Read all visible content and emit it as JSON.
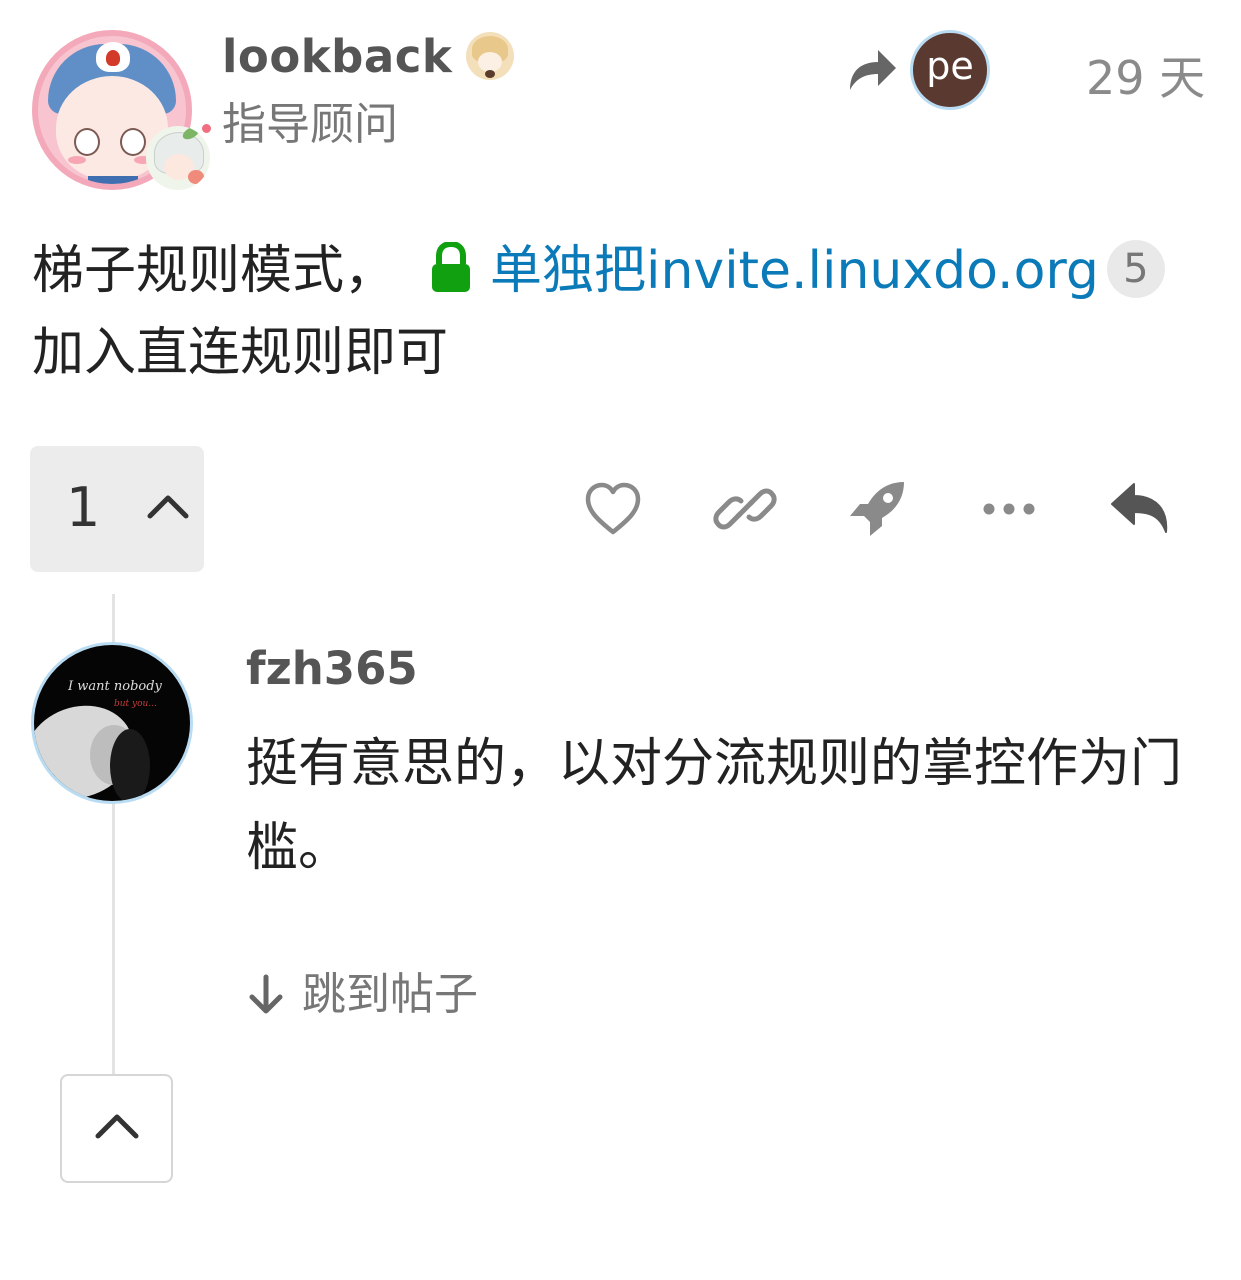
{
  "post": {
    "author": {
      "username": "lookback",
      "title": "指导顾问",
      "avatar_icon": "anime-avatar",
      "flair_icon": "anime-flair",
      "emoji_icon": "anime-emoji"
    },
    "reply_to": {
      "icon": "share-arrow-icon",
      "avatar_text": "pe",
      "avatar_color": "#5a3a30"
    },
    "date": "29 天",
    "body": {
      "text_before": "梯子规则模式，",
      "link_text": "单独把invite.linuxdo.org",
      "link_color": "#0a7ab8",
      "link_clicks": "5",
      "text_after": "加入直连规则即可",
      "lock_icon": "lock-icon",
      "lock_color": "#10a010"
    },
    "actions": {
      "replies_count": "1",
      "buttons": [
        "heart-icon",
        "link-icon",
        "rocket-icon",
        "ellipsis-icon",
        "reply-icon"
      ]
    }
  },
  "embedded_reply": {
    "username": "fzh365",
    "avatar_icon": "photo-avatar",
    "avatar_text_line1": "I want nobody",
    "avatar_text_line2": "but you...",
    "body": "挺有意思的，以对分流规则的掌控作为门槛。",
    "jump_label": "跳到帖子"
  },
  "colors": {
    "text": "#222222",
    "muted": "#777777",
    "link": "#0a7ab8",
    "button_bg": "#ececec"
  }
}
